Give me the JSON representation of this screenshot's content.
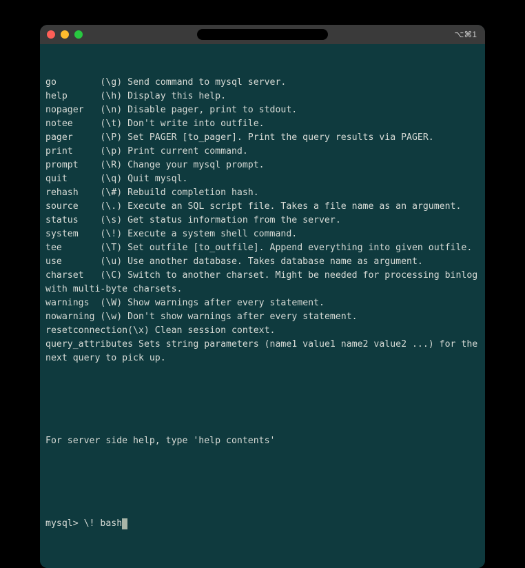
{
  "titlebar": {
    "shortcut": "⌥⌘1"
  },
  "help_rows": [
    {
      "cmd": "go",
      "pad": "        ",
      "code": "(\\g)",
      "desc": " Send command to mysql server."
    },
    {
      "cmd": "help",
      "pad": "      ",
      "code": "(\\h)",
      "desc": " Display this help."
    },
    {
      "cmd": "nopager",
      "pad": "   ",
      "code": "(\\n)",
      "desc": " Disable pager, print to stdout."
    },
    {
      "cmd": "notee",
      "pad": "     ",
      "code": "(\\t)",
      "desc": " Don't write into outfile."
    },
    {
      "cmd": "pager",
      "pad": "     ",
      "code": "(\\P)",
      "desc": " Set PAGER [to_pager]. Print the query results via PAGER."
    },
    {
      "cmd": "print",
      "pad": "     ",
      "code": "(\\p)",
      "desc": " Print current command."
    },
    {
      "cmd": "prompt",
      "pad": "    ",
      "code": "(\\R)",
      "desc": " Change your mysql prompt."
    },
    {
      "cmd": "quit",
      "pad": "      ",
      "code": "(\\q)",
      "desc": " Quit mysql."
    },
    {
      "cmd": "rehash",
      "pad": "    ",
      "code": "(\\#)",
      "desc": " Rebuild completion hash."
    },
    {
      "cmd": "source",
      "pad": "    ",
      "code": "(\\.)",
      "desc": " Execute an SQL script file. Takes a file name as an argument."
    },
    {
      "cmd": "status",
      "pad": "    ",
      "code": "(\\s)",
      "desc": " Get status information from the server."
    },
    {
      "cmd": "system",
      "pad": "    ",
      "code": "(\\!)",
      "desc": " Execute a system shell command."
    },
    {
      "cmd": "tee",
      "pad": "       ",
      "code": "(\\T)",
      "desc": " Set outfile [to_outfile]. Append everything into given outfile."
    },
    {
      "cmd": "use",
      "pad": "       ",
      "code": "(\\u)",
      "desc": " Use another database. Takes database name as argument."
    },
    {
      "cmd": "charset",
      "pad": "   ",
      "code": "(\\C)",
      "desc": " Switch to another charset. Might be needed for processing binlog with multi-byte charsets."
    },
    {
      "cmd": "warnings",
      "pad": "  ",
      "code": "(\\W)",
      "desc": " Show warnings after every statement."
    },
    {
      "cmd": "nowarning",
      "pad": " ",
      "code": "(\\w)",
      "desc": " Don't show warnings after every statement."
    },
    {
      "cmd": "resetconnection",
      "pad": "",
      "code": "(\\x)",
      "desc": " Clean session context."
    },
    {
      "cmd": "query_attributes",
      "pad": " ",
      "code": "",
      "desc": "Sets string parameters (name1 value1 name2 value2 ...) for the next query to pick up."
    }
  ],
  "footer_hint": "For server side help, type 'help contents'",
  "prompt": {
    "prefix": "mysql> ",
    "input": "\\! bash"
  }
}
